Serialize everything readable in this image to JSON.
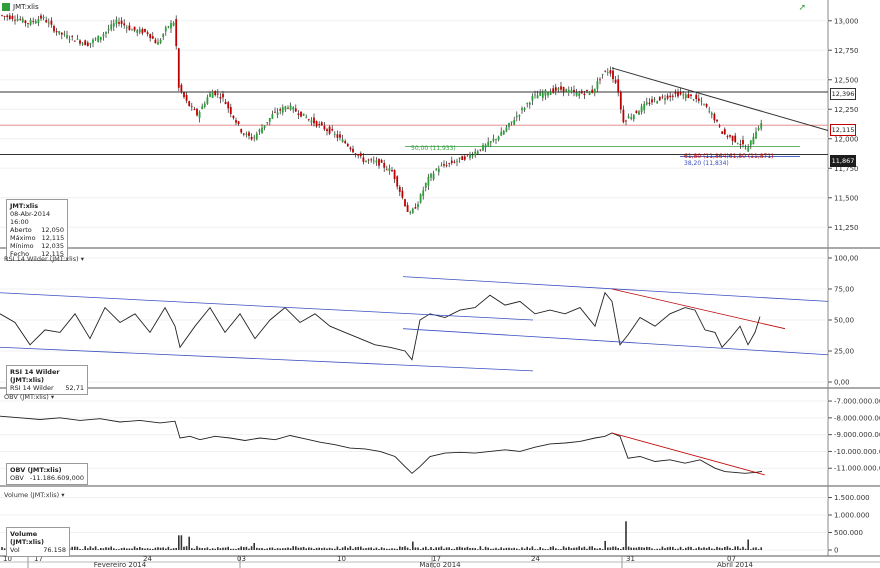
{
  "ticker": "JMT:xlis",
  "price_tags": {
    "upper_line": "12,396",
    "last": "12,115",
    "lower_line": "11,867"
  },
  "fib_labels": {
    "fifty": "50,00 (11,933)",
    "sixty_one": "61,80 (11,864)61,80 (11,871)",
    "thirty_eight": "38,20 (11,834)"
  },
  "info_price": {
    "title": "JMT:xlis",
    "date": "08-Abr-2014 16:00",
    "rows": [
      {
        "label": "Aberto",
        "value": "12,050"
      },
      {
        "label": "Máximo",
        "value": "12,115"
      },
      {
        "label": "Mínimo",
        "value": "12,035"
      },
      {
        "label": "Fecho",
        "value": "12,115"
      }
    ]
  },
  "info_rsi": {
    "title": "RSI 14 Wilder (JMT:xlis)",
    "label": "RSI 14 Wilder",
    "value": "52,71"
  },
  "info_obv": {
    "title": "OBV (JMT:xlis)",
    "label": "OBV",
    "value": "-11.186.609,000"
  },
  "info_vol": {
    "title": "Volume (JMT:xlis)",
    "label": "Vol",
    "value": "76.158"
  },
  "pane_titles": {
    "rsi": "RSI 14 Wilder (JMT:xlis)",
    "obv": "OBV (JMT:xlis)",
    "vol": "Volume (JMT:xlis)"
  },
  "colors": {
    "up": "#2e9e3a",
    "down": "#c00000",
    "channel": "#3a4fc0",
    "trend": "#333333",
    "fib_green": "#2e9e3a"
  },
  "chart_data": [
    {
      "type": "candlestick",
      "ylim": [
        11.125,
        13.125
      ],
      "yticks": [
        "13,000",
        "12,750",
        "12,500",
        "12,250",
        "12,000",
        "11,750",
        "11,500",
        "11,250"
      ],
      "ytick_values": [
        13.0,
        12.75,
        12.5,
        12.25,
        12.0,
        11.75,
        11.5,
        11.25
      ],
      "horizontal_lines": [
        12.396,
        11.867,
        12.115
      ],
      "close_path": [
        [
          0,
          13.05
        ],
        [
          20,
          13.02
        ],
        [
          30,
          12.98
        ],
        [
          45,
          13.03
        ],
        [
          60,
          12.9
        ],
        [
          75,
          12.85
        ],
        [
          90,
          12.8
        ],
        [
          105,
          12.88
        ],
        [
          120,
          13.0
        ],
        [
          135,
          12.92
        ],
        [
          150,
          12.9
        ],
        [
          160,
          12.8
        ],
        [
          170,
          12.95
        ],
        [
          178,
          13.0
        ],
        [
          180,
          12.45
        ],
        [
          190,
          12.3
        ],
        [
          200,
          12.2
        ],
        [
          210,
          12.35
        ],
        [
          215,
          12.4
        ],
        [
          225,
          12.35
        ],
        [
          235,
          12.2
        ],
        [
          245,
          12.05
        ],
        [
          255,
          12.0
        ],
        [
          265,
          12.1
        ],
        [
          275,
          12.2
        ],
        [
          290,
          12.28
        ],
        [
          305,
          12.2
        ],
        [
          320,
          12.12
        ],
        [
          335,
          12.05
        ],
        [
          350,
          11.95
        ],
        [
          365,
          11.82
        ],
        [
          380,
          11.8
        ],
        [
          395,
          11.72
        ],
        [
          405,
          11.5
        ],
        [
          412,
          11.35
        ],
        [
          420,
          11.45
        ],
        [
          430,
          11.65
        ],
        [
          440,
          11.75
        ],
        [
          455,
          11.8
        ],
        [
          470,
          11.85
        ],
        [
          490,
          11.95
        ],
        [
          505,
          12.05
        ],
        [
          520,
          12.2
        ],
        [
          535,
          12.35
        ],
        [
          550,
          12.4
        ],
        [
          565,
          12.42
        ],
        [
          580,
          12.38
        ],
        [
          595,
          12.4
        ],
        [
          605,
          12.55
        ],
        [
          612,
          12.58
        ],
        [
          620,
          12.45
        ],
        [
          625,
          12.15
        ],
        [
          635,
          12.2
        ],
        [
          650,
          12.3
        ],
        [
          665,
          12.35
        ],
        [
          680,
          12.38
        ],
        [
          695,
          12.35
        ],
        [
          705,
          12.3
        ],
        [
          715,
          12.2
        ],
        [
          725,
          12.05
        ],
        [
          735,
          12.0
        ],
        [
          745,
          11.95
        ],
        [
          750,
          11.9
        ],
        [
          757,
          12.05
        ],
        [
          762,
          12.115
        ]
      ]
    },
    {
      "type": "line",
      "name": "RSI 14 Wilder",
      "ylim": [
        0,
        100
      ],
      "yticks": [
        "100,00",
        "75,00",
        "50,00",
        "25,00",
        "0,00"
      ],
      "ytick_values": [
        100,
        75,
        50,
        25,
        0
      ],
      "x": [
        0,
        15,
        30,
        45,
        60,
        75,
        90,
        105,
        120,
        135,
        150,
        165,
        175,
        180,
        195,
        210,
        225,
        240,
        255,
        270,
        285,
        300,
        315,
        330,
        345,
        360,
        375,
        390,
        405,
        412,
        420,
        430,
        445,
        460,
        475,
        490,
        505,
        520,
        535,
        550,
        565,
        580,
        595,
        605,
        612,
        620,
        628,
        640,
        655,
        670,
        685,
        695,
        705,
        715,
        722,
        730,
        740,
        748,
        755,
        760
      ],
      "values": [
        55,
        48,
        30,
        42,
        40,
        55,
        35,
        60,
        48,
        55,
        40,
        60,
        45,
        28,
        45,
        60,
        40,
        55,
        35,
        50,
        60,
        48,
        55,
        45,
        40,
        35,
        30,
        28,
        25,
        18,
        50,
        55,
        52,
        58,
        60,
        70,
        62,
        65,
        55,
        58,
        55,
        60,
        45,
        72,
        65,
        30,
        38,
        52,
        45,
        55,
        60,
        58,
        42,
        40,
        28,
        35,
        45,
        30,
        40,
        52.71
      ]
    },
    {
      "type": "line",
      "name": "OBV",
      "ylim": [
        -11700000000,
        -6700000000
      ],
      "yticks": [
        "-7.000.000.000",
        "-8.000.000.000",
        "-9.000.000.000",
        "-10.000.000.000",
        "-11.000.000.000"
      ],
      "ytick_values": [
        -7000000000,
        -8000000000,
        -9000000000,
        -10000000000,
        -11000000000
      ],
      "x": [
        0,
        20,
        40,
        60,
        80,
        100,
        120,
        140,
        160,
        175,
        180,
        190,
        200,
        215,
        230,
        245,
        260,
        275,
        290,
        305,
        320,
        335,
        350,
        365,
        380,
        395,
        405,
        412,
        420,
        430,
        445,
        460,
        475,
        490,
        505,
        520,
        535,
        550,
        565,
        580,
        595,
        605,
        612,
        620,
        628,
        640,
        655,
        670,
        685,
        700,
        715,
        725,
        735,
        745,
        755,
        762
      ],
      "values": [
        -7900000000.0,
        -8000000000.0,
        -8100000000.0,
        -8000000000.0,
        -8150000000.0,
        -8050000000.0,
        -8250000000.0,
        -8150000000.0,
        -8300000000.0,
        -8200000000.0,
        -9200000000.0,
        -9100000000.0,
        -9300000000.0,
        -9100000000.0,
        -9200000000.0,
        -9350000000.0,
        -9200000000.0,
        -9300000000.0,
        -9050000000.0,
        -9250000000.0,
        -9450000000.0,
        -9600000000.0,
        -9800000000.0,
        -9850000000.0,
        -10000000000.0,
        -10300000000.0,
        -10900000000.0,
        -11300000000.0,
        -10900000000.0,
        -10300000000.0,
        -10100000000.0,
        -10050000000.0,
        -10100000000.0,
        -10000000000.0,
        -9900000000.0,
        -10000000000.0,
        -9750000000.0,
        -9550000000.0,
        -9500000000.0,
        -9400000000.0,
        -9200000000.0,
        -9100000000.0,
        -8900000000.0,
        -9100000000.0,
        -10400000000.0,
        -10300000000.0,
        -10600000000.0,
        -10500000000.0,
        -10700000000.0,
        -10500000000.0,
        -11000000000.0,
        -11200000000.0,
        -11250000000.0,
        -11300000000.0,
        -11250000000.0,
        -11187000000.0
      ]
    },
    {
      "type": "bar",
      "name": "Volume",
      "ylim": [
        0,
        1600000
      ],
      "yticks": [
        "1.500.000",
        "1.000.000",
        "500.000",
        "0"
      ],
      "ytick_values": [
        1500000,
        1000000,
        500000,
        0
      ],
      "spikes": [
        [
          179,
          1500000
        ],
        [
          180,
          420000
        ],
        [
          188,
          380000
        ],
        [
          255,
          200000
        ],
        [
          412,
          240000
        ],
        [
          625,
          820000
        ],
        [
          605,
          260000
        ],
        [
          748,
          300000
        ],
        [
          762,
          76158
        ]
      ]
    }
  ],
  "xaxis": {
    "row1": [
      "10",
      "17",
      "24",
      "03",
      "10",
      "17",
      "24",
      "31",
      "07"
    ],
    "row1_x": [
      3,
      34,
      143,
      237,
      337,
      432,
      531,
      626,
      727
    ],
    "row2": [
      "Fevereiro 2014",
      "Março 2014",
      "Abril 2014"
    ],
    "row2_x": [
      120,
      440,
      735
    ],
    "divider_x": [
      28,
      240,
      432,
      622
    ]
  }
}
